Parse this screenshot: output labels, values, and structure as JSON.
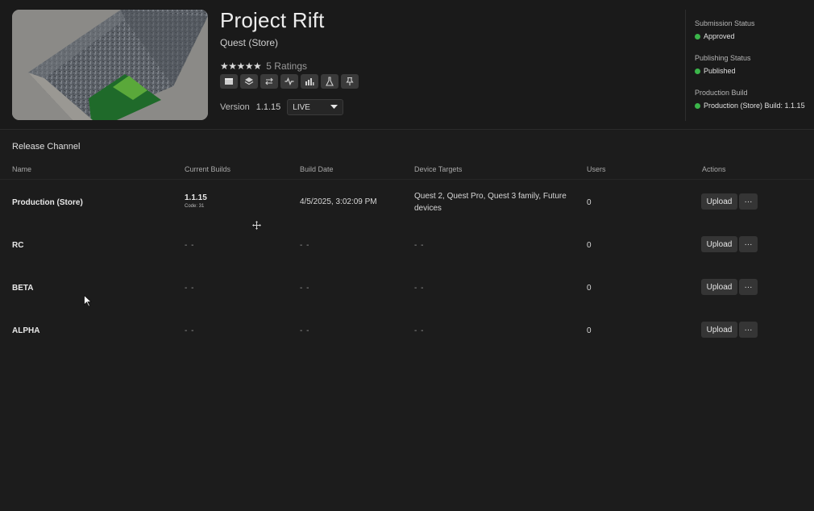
{
  "app": {
    "title": "Project Rift",
    "subtitle": "Quest (Store)",
    "rating": {
      "stars": 5,
      "text": "5 Ratings"
    },
    "toolbar_icons": [
      "store-icon",
      "layers-icon",
      "swap-icon",
      "activity-icon",
      "analytics-icon",
      "lab-flask-icon",
      "pin-icon"
    ],
    "version": {
      "label": "Version",
      "value": "1.1.15",
      "channel_select": "LIVE"
    }
  },
  "status": {
    "submission": {
      "label": "Submission Status",
      "value": "Approved",
      "color": "#3bb54a"
    },
    "publishing": {
      "label": "Publishing Status",
      "value": "Published",
      "color": "#3bb54a"
    },
    "production_build": {
      "label": "Production Build",
      "value": "Production (Store) Build: 1.1.15",
      "color": "#3bb54a"
    }
  },
  "release": {
    "section_title": "Release Channel",
    "columns": [
      "Name",
      "Current Builds",
      "Build Date",
      "Device Targets",
      "Users",
      "Actions"
    ],
    "rows": [
      {
        "name": "Production (Store)",
        "build": "1.1.15",
        "code": "Code: 31",
        "date": "4/5/2025, 3:02:09 PM",
        "devices": "Quest 2, Quest Pro, Quest 3 family, Future devices",
        "users": "0",
        "upload": "Upload",
        "more": "···"
      },
      {
        "name": "RC",
        "build": "- -",
        "code": "",
        "date": "- -",
        "devices": "- -",
        "users": "0",
        "upload": "Upload",
        "more": "···"
      },
      {
        "name": "BETA",
        "build": "- -",
        "code": "",
        "date": "- -",
        "devices": "- -",
        "users": "0",
        "upload": "Upload",
        "more": "···"
      },
      {
        "name": "ALPHA",
        "build": "- -",
        "code": "",
        "date": "- -",
        "devices": "- -",
        "users": "0",
        "upload": "Upload",
        "more": "···"
      }
    ]
  }
}
